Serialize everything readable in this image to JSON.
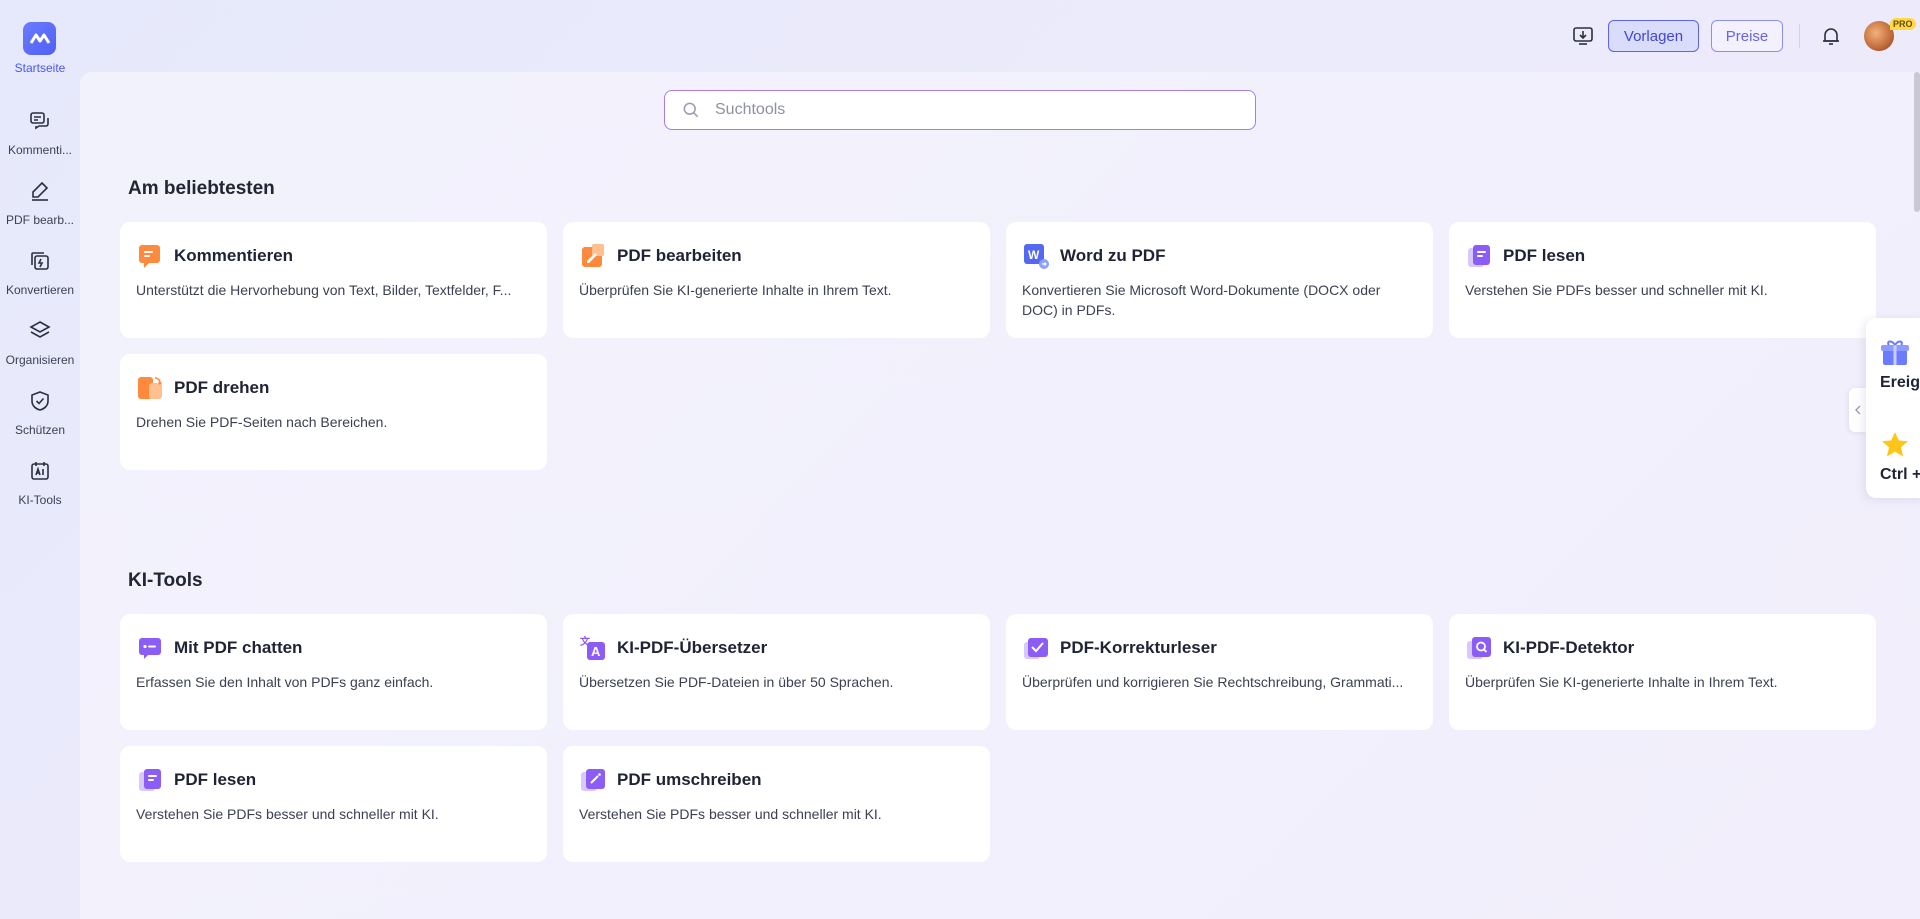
{
  "sidebar": {
    "logo_label": "Startseite",
    "items": [
      {
        "label": "Kommenti...",
        "icon": "comment-icon"
      },
      {
        "label": "PDF bearb...",
        "icon": "edit-icon"
      },
      {
        "label": "Konvertieren",
        "icon": "convert-icon"
      },
      {
        "label": "Organisieren",
        "icon": "layers-icon"
      },
      {
        "label": "Schützen",
        "icon": "shield-icon"
      },
      {
        "label": "KI-Tools",
        "icon": "ai-tools-icon"
      }
    ]
  },
  "header": {
    "vorlagen_label": "Vorlagen",
    "preise_label": "Preise",
    "pro_badge": "PRO"
  },
  "search": {
    "placeholder": "Suchtools"
  },
  "sections": {
    "popular": {
      "title": "Am beliebtesten",
      "cards": [
        {
          "title": "Kommentieren",
          "desc": "Unterstützt die Hervorhebung von Text, Bilder, Textfelder, F...",
          "icon": "comment-orange-icon"
        },
        {
          "title": "PDF bearbeiten",
          "desc": "Überprüfen Sie KI-generierte Inhalte in Ihrem Text.",
          "icon": "edit-orange-icon"
        },
        {
          "title": "Word zu PDF",
          "desc": "Konvertieren Sie Microsoft Word-Dokumente (DOCX oder DOC) in PDFs.",
          "icon": "word-icon"
        },
        {
          "title": "PDF lesen",
          "desc": "Verstehen Sie PDFs besser und schneller mit KI.",
          "icon": "pdf-read-icon"
        },
        {
          "title": "PDF drehen",
          "desc": "Drehen Sie PDF-Seiten nach Bereichen.",
          "icon": "rotate-icon"
        }
      ]
    },
    "ai": {
      "title": "KI-Tools",
      "cards": [
        {
          "title": "Mit PDF chatten",
          "desc": "Erfassen Sie den Inhalt von PDFs ganz einfach.",
          "icon": "chat-icon"
        },
        {
          "title": "KI-PDF-Übersetzer",
          "desc": "Übersetzen Sie PDF-Dateien in über 50 Sprachen.",
          "icon": "translate-icon"
        },
        {
          "title": "PDF-Korrekturleser",
          "desc": "Überprüfen und korrigieren Sie Rechtschreibung, Grammati...",
          "icon": "proofread-icon"
        },
        {
          "title": "KI-PDF-Detektor",
          "desc": "Überprüfen Sie KI-generierte Inhalte in Ihrem Text.",
          "icon": "detector-icon"
        },
        {
          "title": "PDF lesen",
          "desc": "Verstehen Sie PDFs besser und schneller mit KI.",
          "icon": "pdf-read-icon"
        },
        {
          "title": "PDF umschreiben",
          "desc": "Verstehen Sie PDFs besser und schneller mit KI.",
          "icon": "rewrite-icon"
        }
      ]
    }
  },
  "float_panel": {
    "events_label": "Ereig",
    "shortcut_label": "Ctrl +"
  },
  "colors": {
    "accent": "#4f5ff5",
    "orange": "#ff8a3d",
    "purple": "#8b5cf6"
  }
}
